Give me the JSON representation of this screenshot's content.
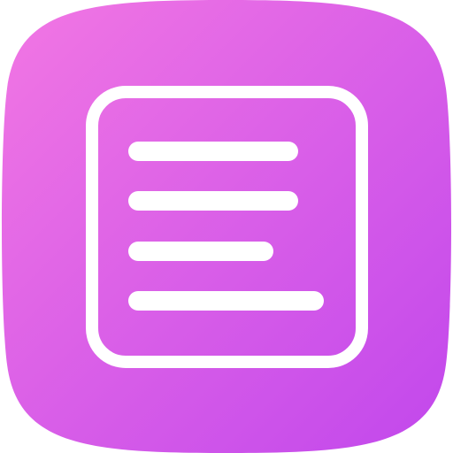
{
  "app_icon": {
    "icon": "document-text-icon",
    "background": {
      "gradient_start": "#f277e3",
      "gradient_end": "#c147ec"
    },
    "glyph_color": "#ffffff",
    "text_lines_count": 4
  }
}
